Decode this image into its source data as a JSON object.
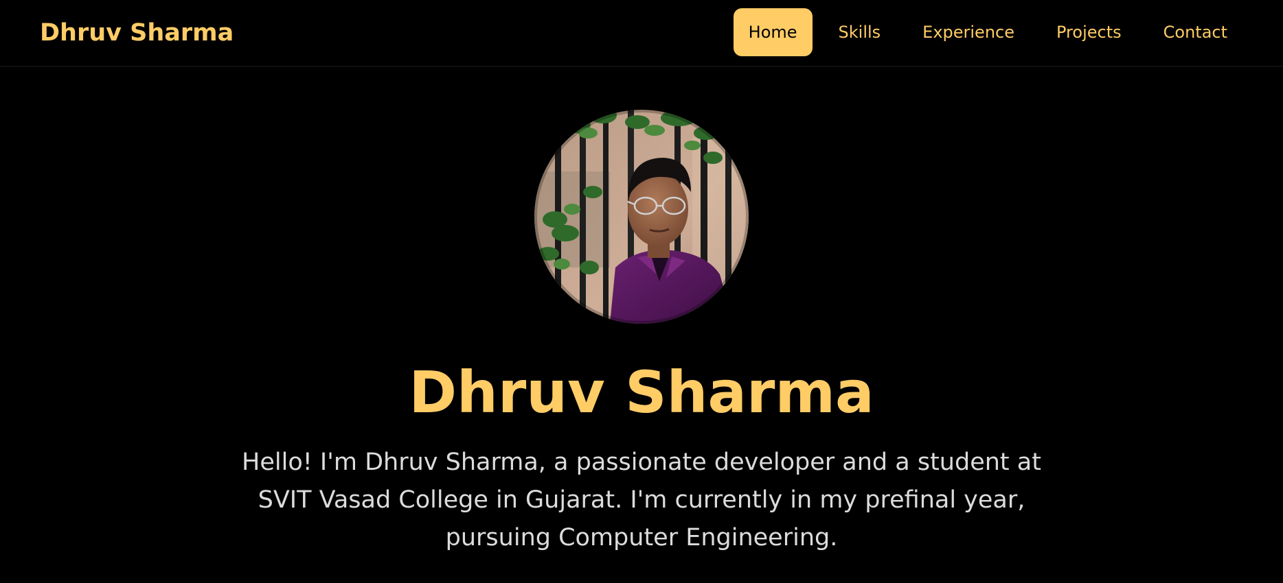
{
  "theme": {
    "accent": "#ffcc66",
    "background": "#000000",
    "text": "#dcdcdc",
    "active_text": "#000000"
  },
  "navbar": {
    "brand": "Dhruv Sharma",
    "links": [
      {
        "label": "Home",
        "active": true
      },
      {
        "label": "Skills",
        "active": false
      },
      {
        "label": "Experience",
        "active": false
      },
      {
        "label": "Projects",
        "active": false
      },
      {
        "label": "Contact",
        "active": false
      }
    ]
  },
  "hero": {
    "avatar_icon": "profile-photo",
    "title": "Dhruv Sharma",
    "bio": "Hello! I'm Dhruv Sharma, a passionate developer and a student at SVIT Vasad College in Gujarat. I'm currently in my prefinal year, pursuing Computer Engineering."
  }
}
